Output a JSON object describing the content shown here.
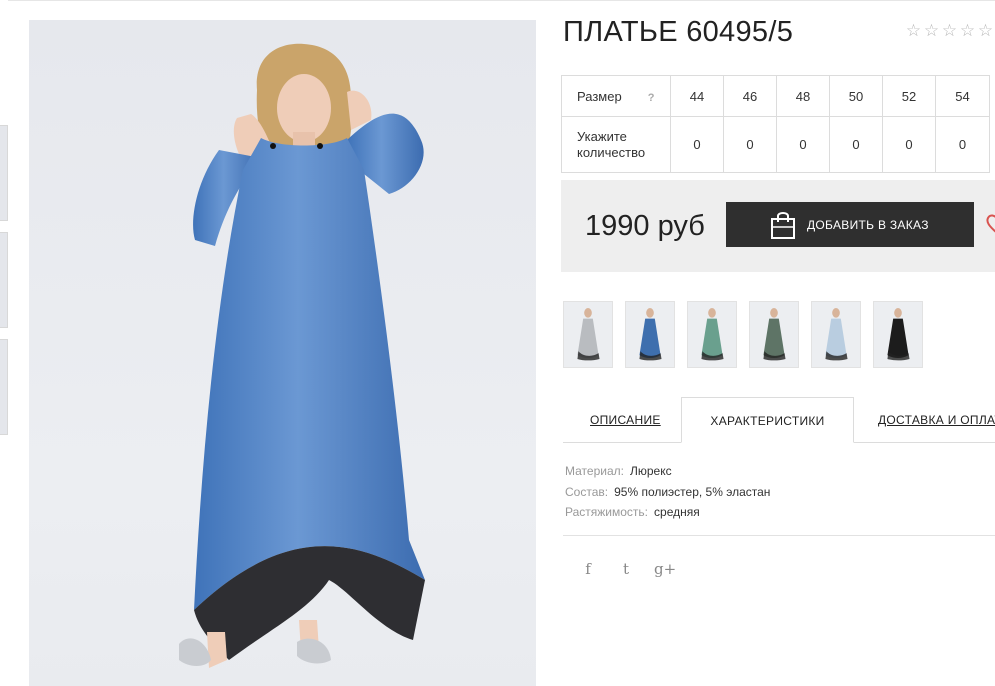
{
  "product": {
    "title": "ПЛАТЬЕ 60495/5",
    "rating": {
      "max": 5,
      "value": 0
    }
  },
  "sizes": {
    "size_label": "Размер",
    "help_symbol": "?",
    "qty_label_line1": "Укажите",
    "qty_label_line2": "количество",
    "values": [
      "44",
      "46",
      "48",
      "50",
      "52",
      "54"
    ],
    "quantities": [
      "0",
      "0",
      "0",
      "0",
      "0",
      "0"
    ]
  },
  "purchase": {
    "price": "1990 руб",
    "add_to_order_label": "ДОБАВИТЬ В ЗАКАЗ"
  },
  "variants": [
    {
      "color": "#b9bcc0"
    },
    {
      "color": "#3e6fae"
    },
    {
      "color": "#6aa08e"
    },
    {
      "color": "#5e7466"
    },
    {
      "color": "#b9cde0"
    },
    {
      "color": "#1c1c1c"
    }
  ],
  "tabs": [
    {
      "label": "ОПИСАНИЕ"
    },
    {
      "label": "ХАРАКТЕРИСТИКИ"
    },
    {
      "label": "ДОСТАВКА И ОПЛАТА"
    }
  ],
  "characteristics": [
    {
      "key": "Материал:",
      "value": "Люрекс"
    },
    {
      "key": "Состав:",
      "value": "95% полиэстер, 5% эластан"
    },
    {
      "key": "Растяжимость:",
      "value": "средняя"
    }
  ],
  "social": {
    "facebook": "f",
    "twitter": "t",
    "googleplus": "g+"
  },
  "colors": {
    "dress": "#4a7fc6",
    "button": "#2f2f2f",
    "price_bg": "#eeeeee",
    "heart": "#d9534f"
  }
}
